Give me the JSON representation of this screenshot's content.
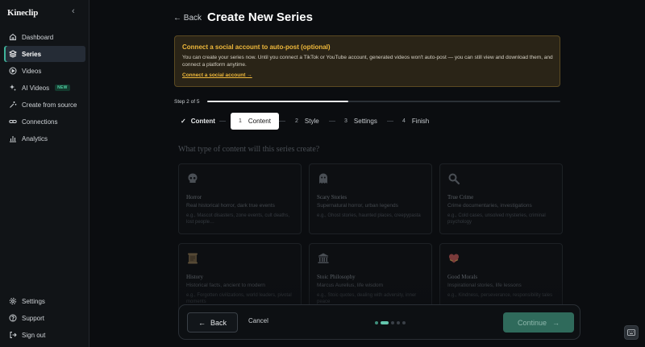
{
  "app": {
    "name": "Kineclip"
  },
  "sidebar": {
    "items": [
      {
        "label": "Dashboard",
        "icon": "home-icon",
        "active": false
      },
      {
        "label": "Series",
        "icon": "layers-icon",
        "active": true
      },
      {
        "label": "Videos",
        "icon": "play-circle-icon",
        "active": false
      },
      {
        "label": "AI Videos",
        "icon": "sparkles-icon",
        "badge": "NEW",
        "active": false
      },
      {
        "label": "Create from source",
        "icon": "magic-wand-icon",
        "active": false
      },
      {
        "label": "Connections",
        "icon": "link-icon",
        "active": false
      },
      {
        "label": "Analytics",
        "icon": "bar-chart-icon",
        "active": false
      }
    ],
    "bottom": [
      {
        "label": "Settings",
        "icon": "gear-icon"
      },
      {
        "label": "Support",
        "icon": "help-circle-icon"
      },
      {
        "label": "Sign out",
        "icon": "logout-icon"
      }
    ]
  },
  "header": {
    "back": "Back",
    "title": "Create New Series"
  },
  "alert": {
    "title": "Connect a social account to auto-post (optional)",
    "body": "You can create your series now. Until you connect a TikTok or YouTube account, generated videos won't auto-post — you can still view and download them, and connect a platform anytime.",
    "link": "Connect a social account →"
  },
  "progress": {
    "label": "Step 2 of 5",
    "fraction": 0.4
  },
  "stepper": {
    "done": {
      "label": "Content"
    },
    "steps": [
      {
        "num": "1",
        "label": "Content"
      },
      {
        "num": "2",
        "label": "Style"
      },
      {
        "num": "3",
        "label": "Settings"
      },
      {
        "num": "4",
        "label": "Finish"
      }
    ]
  },
  "question": "What type of content will this series create?",
  "cards": [
    {
      "title": "Horror",
      "desc": "Real historical horror, dark true events",
      "example": "e.g., Mascot disasters, zone events, cult deaths, lost people…",
      "icon": "skull-icon"
    },
    {
      "title": "Scary Stories",
      "desc": "Supernatural horror, urban legends",
      "example": "e.g., Ghost stories, haunted places, creepypasta",
      "icon": "ghost-icon"
    },
    {
      "title": "True Crime",
      "desc": "Crime documentaries, investigations",
      "example": "e.g., Cold cases, unsolved mysteries, criminal psychology",
      "icon": "magnifier-icon"
    },
    {
      "title": "History",
      "desc": "Historical facts, ancient to modern",
      "example": "e.g., Forgotten civilizations, world leaders, pivotal moments",
      "icon": "scroll-icon"
    },
    {
      "title": "Stoic Philosophy",
      "desc": "Marcus Aurelius, life wisdom",
      "example": "e.g., Stoic quotes, dealing with adversity, inner peace",
      "icon": "temple-icon"
    },
    {
      "title": "Good Morals",
      "desc": "Inspirational stories, life lessons",
      "example": "e.g., Kindness, perseverance, responsibility tales",
      "icon": "heart-hands-icon"
    }
  ],
  "footer": {
    "back": "Back",
    "cancel": "Cancel",
    "continue": "Continue"
  },
  "colors": {
    "accent": "#3fb39a",
    "warning": "#f0b93b",
    "background": "#0b0d10"
  }
}
